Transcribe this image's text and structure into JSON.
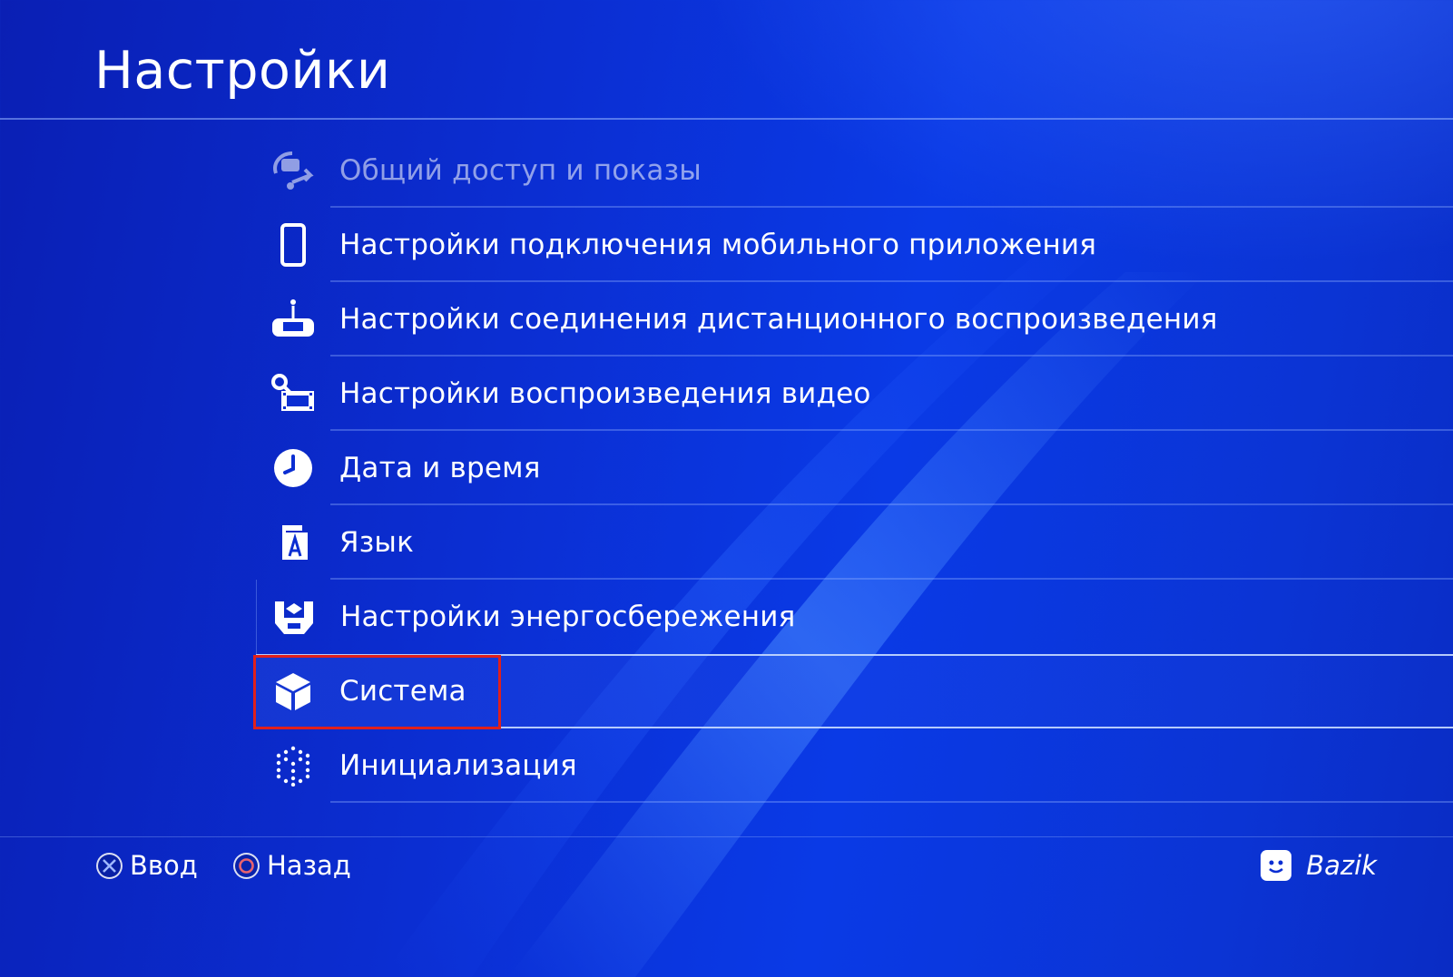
{
  "header": {
    "title": "Настройки"
  },
  "menu": {
    "items": [
      {
        "label": "Общий доступ и показы",
        "icon": "share-broadcast-icon",
        "state": "dimmed"
      },
      {
        "label": "Настройки подключения мобильного приложения",
        "icon": "smartphone-icon"
      },
      {
        "label": "Настройки соединения дистанционного воспроизведения",
        "icon": "remote-play-icon"
      },
      {
        "label": "Настройки воспроизведения видео",
        "icon": "video-settings-icon"
      },
      {
        "label": "Дата и время",
        "icon": "clock-icon"
      },
      {
        "label": "Язык",
        "icon": "language-icon"
      },
      {
        "label": "Настройки энергосбережения",
        "icon": "power-save-icon"
      },
      {
        "label": "Система",
        "icon": "system-cube-icon",
        "state": "focused"
      },
      {
        "label": "Инициализация",
        "icon": "initialization-icon"
      }
    ]
  },
  "footer": {
    "enter_label": "Ввод",
    "enter_icon": "cross-button-icon",
    "back_label": "Назад",
    "back_icon": "circle-button-icon",
    "user_name": "Bazik",
    "user_icon": "user-avatar-icon"
  },
  "colors": {
    "background": "#0b2ed2",
    "text": "#ffffff",
    "annotation": "#e0201c",
    "circle_button": "#e8636f"
  }
}
